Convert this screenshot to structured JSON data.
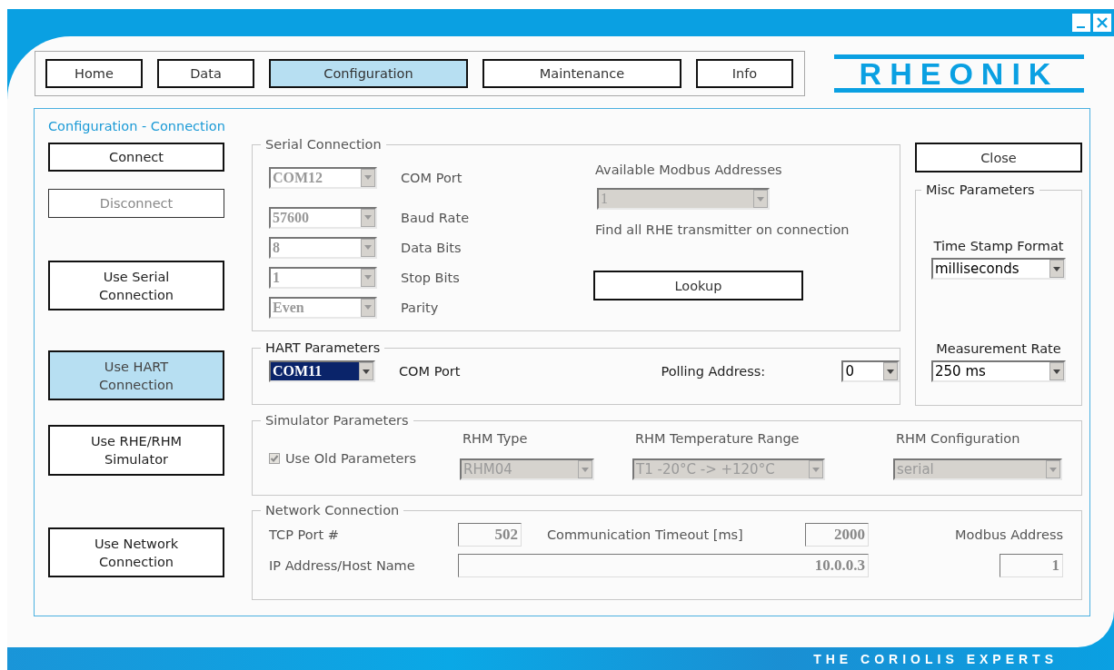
{
  "tabs": [
    {
      "label": "Home",
      "selected": false
    },
    {
      "label": "Data",
      "selected": false
    },
    {
      "label": "Configuration",
      "selected": true
    },
    {
      "label": "Maintenance",
      "selected": false
    },
    {
      "label": "Info",
      "selected": false
    }
  ],
  "logo": "RHEONIK",
  "panel_title": "Configuration - Connection",
  "side_buttons": [
    {
      "label": "Connect",
      "selected": false,
      "disabled": false
    },
    {
      "label": "Disconnect",
      "selected": false,
      "disabled": true
    },
    {
      "label": "Use Serial Connection",
      "selected": false,
      "disabled": false
    },
    {
      "label": "Use HART Connection",
      "selected": true,
      "disabled": false
    },
    {
      "label": "Use RHE/RHM Simulator",
      "selected": false,
      "disabled": false
    },
    {
      "label": "Use Network Connection",
      "selected": false,
      "disabled": false
    }
  ],
  "serial": {
    "title": "Serial Connection",
    "fields": [
      {
        "value": "COM12",
        "label": "COM Port",
        "disabled": true
      },
      {
        "value": "57600",
        "label": "Baud Rate",
        "disabled": true
      },
      {
        "value": "8",
        "label": "Data Bits",
        "disabled": true
      },
      {
        "value": "1",
        "label": "Stop Bits",
        "disabled": true
      },
      {
        "value": "Even",
        "label": "Parity",
        "disabled": true
      }
    ],
    "modbus_label": "Available Modbus Addresses",
    "modbus_value": "1",
    "modbus_disabled": true,
    "find_text": "Find all RHE transmitter on connection",
    "lookup_button": "Lookup"
  },
  "hart": {
    "title": "HART Parameters",
    "com_value": "COM11",
    "com_focused": true,
    "com_label": "COM Port",
    "polling_label": "Polling Address:",
    "polling_value": "0"
  },
  "close_button": "Close",
  "misc": {
    "title": "Misc Parameters",
    "timestamp_label": "Time Stamp Format",
    "timestamp_value": "milliseconds",
    "rate_label": "Measurement Rate",
    "rate_value": "250 ms"
  },
  "simulator": {
    "title": "Simulator Parameters",
    "checkbox": {
      "label": "Use Old Parameters",
      "checked": true,
      "disabled": true
    },
    "columns": [
      {
        "label": "RHM Type",
        "value": "RHM04",
        "disabled": true
      },
      {
        "label": "RHM Temperature Range",
        "value": "T1  -20°C -> +120°C",
        "disabled": true
      },
      {
        "label": "RHM Configuration",
        "value": "serial",
        "disabled": true
      }
    ]
  },
  "network": {
    "title": "Network Connection",
    "tcp_label": "TCP Port #",
    "tcp_value": "502",
    "timeout_label": "Communication Timeout [ms]",
    "timeout_value": "2000",
    "modbus_label": "Modbus Address",
    "ip_label": "IP Address/Host Name",
    "ip_value": "10.0.0.3",
    "modbus_value": "1"
  },
  "footer": "THE CORIOLIS EXPERTS"
}
